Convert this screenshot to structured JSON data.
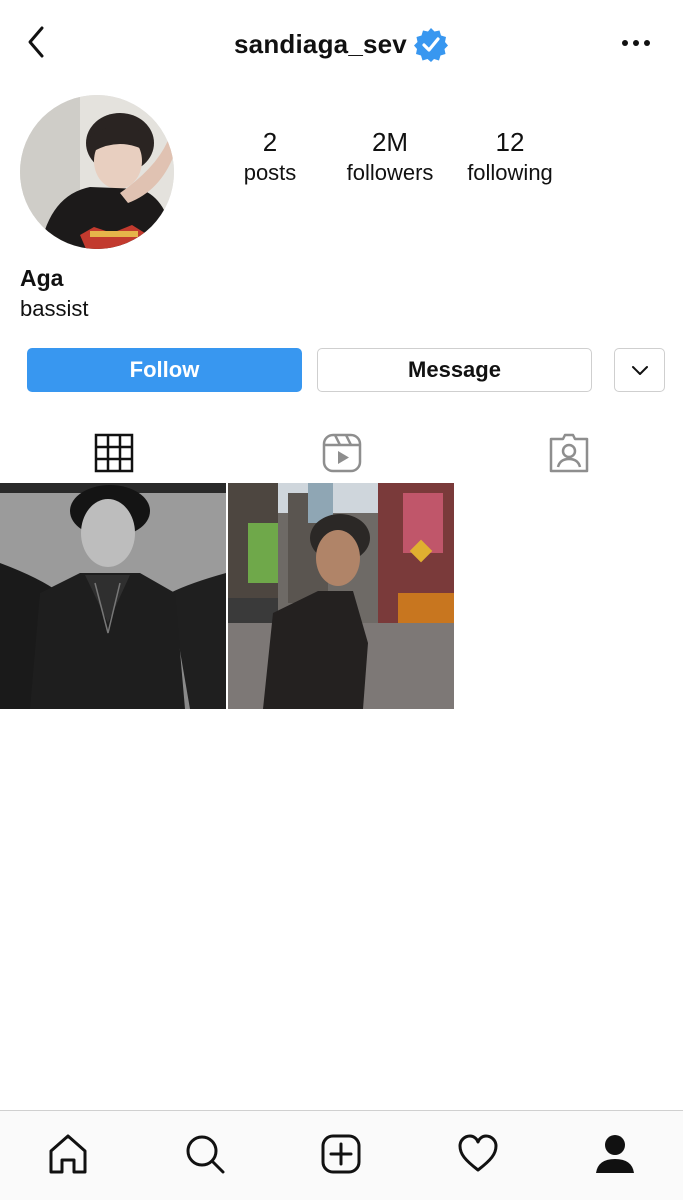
{
  "header": {
    "username": "sandiaga_sev",
    "back_icon": "chevron-left-icon",
    "verified_icon": "verified-badge-icon",
    "more_icon": "more-horizontal-icon",
    "verified_color": "#3897f0"
  },
  "profile": {
    "name": "Aga",
    "bio": "bassist",
    "stats": [
      {
        "value": "2",
        "label": "posts"
      },
      {
        "value": "2M",
        "label": "followers"
      },
      {
        "value": "12",
        "label": "following"
      }
    ]
  },
  "actions": {
    "follow_label": "Follow",
    "message_label": "Message",
    "dropdown_icon": "chevron-down-icon",
    "follow_color": "#3897f0"
  },
  "tabs": [
    {
      "name": "grid",
      "icon": "grid-icon",
      "active": true
    },
    {
      "name": "reels",
      "icon": "reels-icon",
      "active": false
    },
    {
      "name": "tagged",
      "icon": "tagged-person-icon",
      "active": false
    }
  ],
  "posts": [
    {
      "description": "black and white portrait"
    },
    {
      "description": "city street photo"
    }
  ],
  "bottom_nav": [
    {
      "name": "home",
      "icon": "home-icon"
    },
    {
      "name": "search",
      "icon": "search-icon"
    },
    {
      "name": "new-post",
      "icon": "add-post-icon"
    },
    {
      "name": "activity",
      "icon": "heart-icon"
    },
    {
      "name": "profile",
      "icon": "profile-icon",
      "active": true
    }
  ]
}
